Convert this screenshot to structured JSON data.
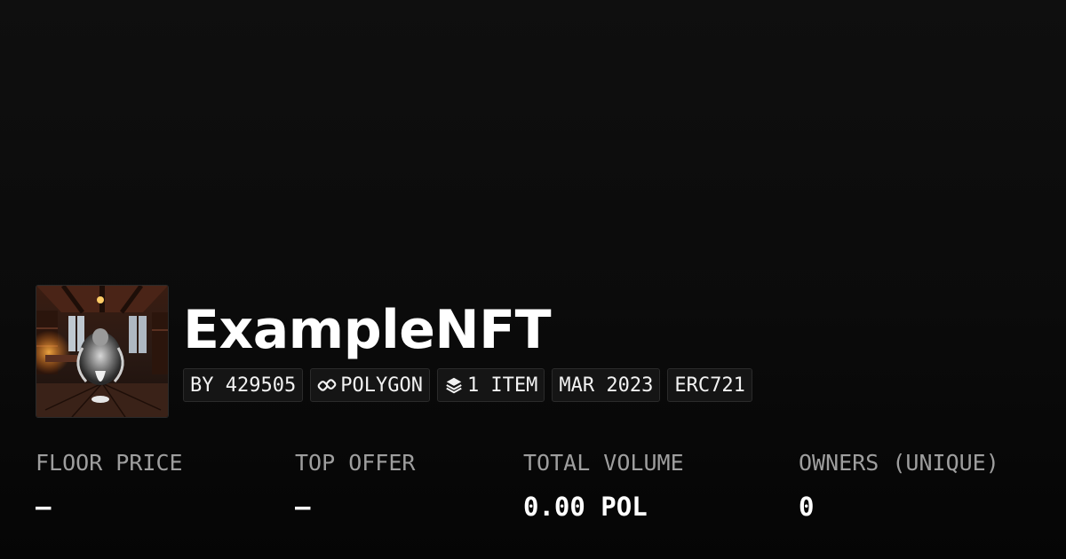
{
  "collection": {
    "name": "ExampleNFT",
    "image_icon": "collection-thumbnail"
  },
  "chips": {
    "creator": "BY 429505",
    "chain": "POLYGON",
    "chain_icon": "polygon-link-icon",
    "items": "1 ITEM",
    "items_icon": "layers-icon",
    "date": "MAR 2023",
    "standard": "ERC721"
  },
  "stats": {
    "floor_price": {
      "label": "FLOOR PRICE",
      "value": "—"
    },
    "top_offer": {
      "label": "TOP OFFER",
      "value": "—"
    },
    "total_volume": {
      "label": "TOTAL VOLUME",
      "value": "0.00 POL"
    },
    "owners": {
      "label": "OWNERS (UNIQUE)",
      "value": "0"
    }
  },
  "colors": {
    "background": "#0d0d0d",
    "chip_background": "#151515",
    "label": "#9e9e9e",
    "text": "#ffffff"
  }
}
